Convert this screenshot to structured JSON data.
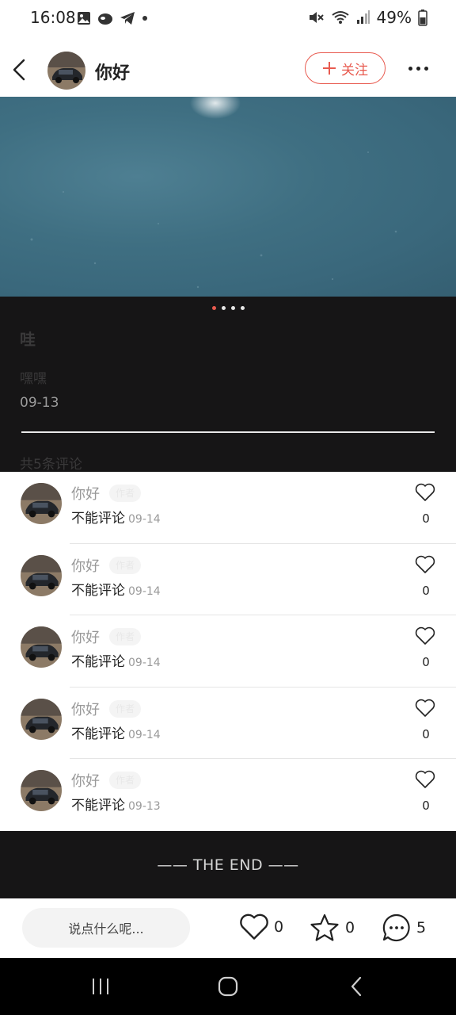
{
  "status_bar": {
    "time": "16:08",
    "battery": "49%",
    "left_icons": [
      "image-icon",
      "cloud-icon",
      "telegram-icon",
      "dot-icon"
    ],
    "right_icons": [
      "mute-icon",
      "wifi-icon",
      "signal-icon",
      "battery-icon"
    ]
  },
  "header": {
    "name": "你好",
    "follow_label": "关注"
  },
  "post": {
    "page_count": 4,
    "active_page": 1,
    "title": "哇",
    "body": "嘿嘿",
    "date": "09-13",
    "comment_count_text": "共5条评论"
  },
  "comments": [
    {
      "name": "你好",
      "badge": "作者",
      "text": "不能评论",
      "time": "09-14",
      "likes": "0"
    },
    {
      "name": "你好",
      "badge": "作者",
      "text": "不能评论",
      "time": "09-14",
      "likes": "0"
    },
    {
      "name": "你好",
      "badge": "作者",
      "text": "不能评论",
      "time": "09-14",
      "likes": "0"
    },
    {
      "name": "你好",
      "badge": "作者",
      "text": "不能评论",
      "time": "09-14",
      "likes": "0"
    },
    {
      "name": "你好",
      "badge": "作者",
      "text": "不能评论",
      "time": "09-13",
      "likes": "0"
    }
  ],
  "end_text": "—— THE END ——",
  "bottom_bar": {
    "input_placeholder": "说点什么呢...",
    "likes": "0",
    "favorites": "0",
    "comments": "5"
  },
  "colors": {
    "accent": "#e85a4f",
    "dark_bg": "#161516"
  }
}
